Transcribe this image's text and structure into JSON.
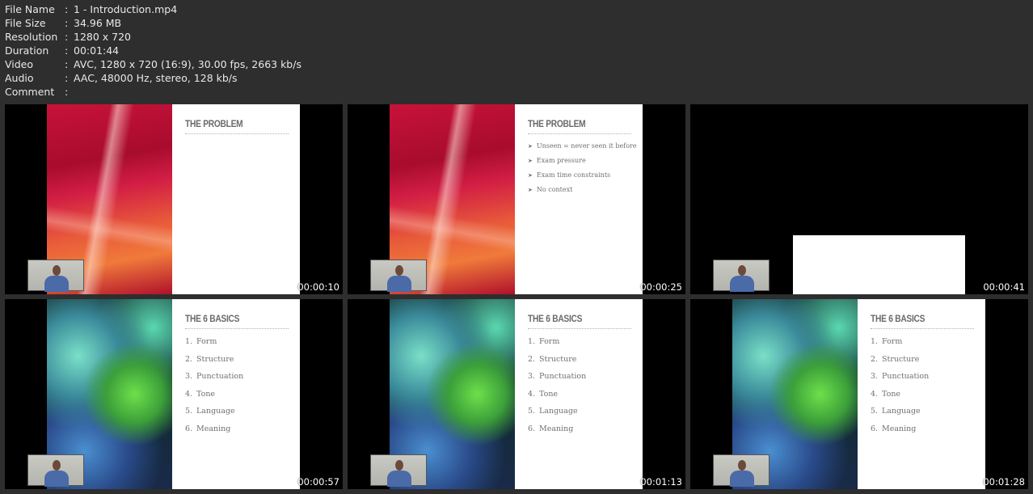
{
  "info": [
    {
      "key": "File Name",
      "value": "1 - Introduction.mp4"
    },
    {
      "key": "File Size",
      "value": "34.96 MB"
    },
    {
      "key": "Resolution",
      "value": "1280 x 720"
    },
    {
      "key": "Duration",
      "value": "00:01:44"
    },
    {
      "key": "Video",
      "value": "AVC, 1280 x 720 (16:9), 30.00 fps, 2663 kb/s"
    },
    {
      "key": "Audio",
      "value": "AAC, 48000 Hz, stereo, 128 kb/s"
    },
    {
      "key": "Comment",
      "value": ""
    }
  ],
  "separator": ":",
  "thumbnails": [
    {
      "timestamp": "00:00:10",
      "style": "red",
      "title": "THE PROBLEM",
      "bullets": [],
      "numbered": []
    },
    {
      "timestamp": "00:00:25",
      "style": "red",
      "title": "THE PROBLEM",
      "bullet_glyph": "➤",
      "bullets": [
        "Unseen = never seen it before",
        "Exam pressure",
        "Exam time constraints",
        "No context"
      ],
      "numbered": []
    },
    {
      "timestamp": "00:00:41",
      "style": "blank",
      "title": "",
      "bullets": [],
      "numbered": []
    },
    {
      "timestamp": "00:00:57",
      "style": "green",
      "title": "THE 6 BASICS",
      "bullets": [],
      "numbered": [
        "Form",
        "Structure",
        "Punctuation",
        "Tone",
        "Language",
        "Meaning"
      ]
    },
    {
      "timestamp": "00:01:13",
      "style": "green",
      "title": "THE 6 BASICS",
      "bullets": [],
      "numbered": [
        "Form",
        "Structure",
        "Punctuation",
        "Tone",
        "Language",
        "Meaning"
      ]
    },
    {
      "timestamp": "00:01:28",
      "style": "green",
      "title": "THE 6 BASICS",
      "bullets": [],
      "numbered": [
        "Form",
        "Structure",
        "Punctuation",
        "Tone",
        "Language",
        "Meaning"
      ]
    }
  ]
}
